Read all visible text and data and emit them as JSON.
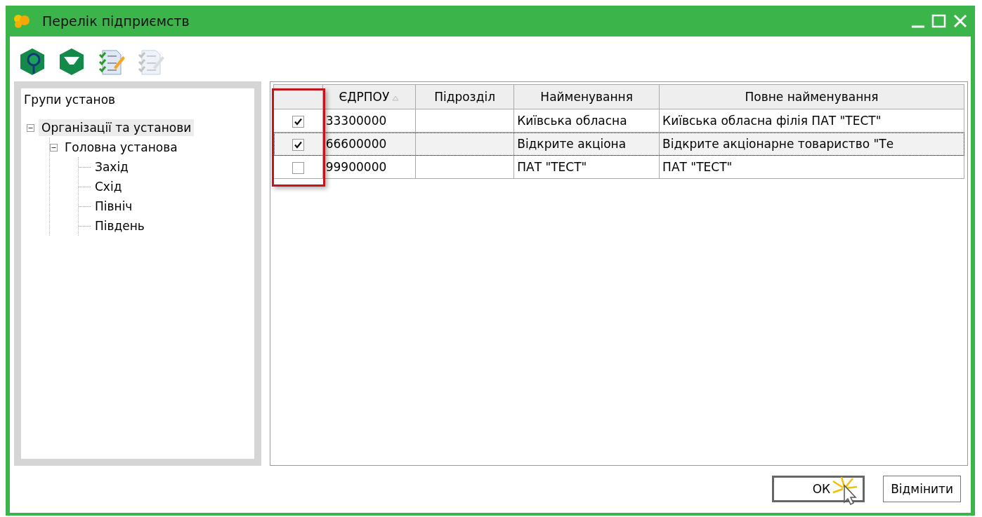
{
  "window": {
    "title": "Перелік підприємств"
  },
  "toolbar": [
    {
      "kind": "find",
      "disabled": false
    },
    {
      "kind": "filter",
      "disabled": false
    },
    {
      "kind": "check",
      "disabled": false
    },
    {
      "kind": "uncheck",
      "disabled": true
    }
  ],
  "tree": {
    "title": "Групи установ",
    "items": [
      {
        "label": "Організації та установи",
        "selected": true,
        "expanded": true,
        "children": [
          {
            "label": "Головна установа",
            "selected": false,
            "expanded": true,
            "children": [
              {
                "label": "Захід",
                "selected": false
              },
              {
                "label": "Схід",
                "selected": false
              },
              {
                "label": "Північ",
                "selected": false
              },
              {
                "label": "Південь",
                "selected": false
              }
            ]
          }
        ]
      }
    ]
  },
  "table": {
    "checkbox_column_highlighted": true,
    "columns": [
      {
        "label": "ЄДРПОУ",
        "sorted": true
      },
      {
        "label": "Підрозділ"
      },
      {
        "label": "Найменування"
      },
      {
        "label": "Повне найменування"
      }
    ],
    "rows": [
      {
        "checked": true,
        "selected": false,
        "cells": [
          "33300000",
          "",
          "Київська обласна",
          "Київська обласна філія ПАТ \"ТЕСТ\""
        ]
      },
      {
        "checked": true,
        "selected": true,
        "cells": [
          "66600000",
          "",
          "Відкрите акціона",
          "Відкрите акціонарне товариство \"Те"
        ]
      },
      {
        "checked": false,
        "selected": false,
        "cells": [
          "99900000",
          "",
          "ПАТ \"ТЕСТ\"",
          "ПАТ \"ТЕСТ\""
        ]
      }
    ]
  },
  "buttons": [
    {
      "label": "ОК",
      "default": true
    },
    {
      "label": "Відмінити",
      "default": false
    }
  ]
}
